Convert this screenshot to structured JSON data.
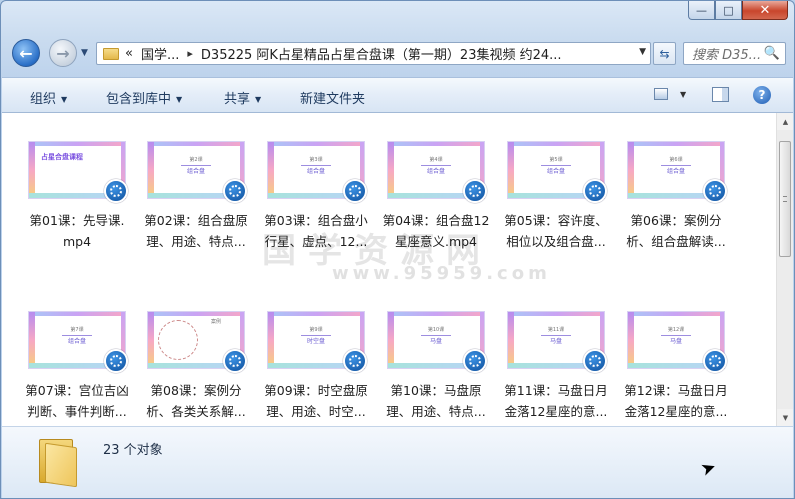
{
  "window": {
    "minimize": "—",
    "maximize": "□",
    "close": "✕"
  },
  "nav": {
    "back": "←",
    "forward": "→",
    "history": "▼"
  },
  "address": {
    "nav_arrows": "«",
    "crumbs": [
      "国学...",
      "D35225 阿K占星精品占星合盘课（第一期）23集视频 约24..."
    ],
    "dropdown": "▼"
  },
  "refresh": "⇆",
  "search": {
    "placeholder": "搜索 D35...",
    "icon": "🔍"
  },
  "toolbar": {
    "organize": "组织",
    "include_library": "包含到库中",
    "share": "共享",
    "new_folder": "新建文件夹",
    "arrow": "▼",
    "help": "?"
  },
  "watermark": {
    "text": "国学资源网",
    "url": "www.95959.com"
  },
  "files": [
    {
      "name_line1": "第01课：先导课.",
      "name_line2": "mp4",
      "thumb_type": "cover",
      "thumb_title": "占星合盘课程"
    },
    {
      "name_line1": "第02课：组合盘原",
      "name_line2": "理、用途、特点...",
      "thumb_type": "slide",
      "thumb_label": "第2课",
      "thumb_title": "组合盘"
    },
    {
      "name_line1": "第03课：组合盘小",
      "name_line2": "行星、虚点、12...",
      "thumb_type": "slide",
      "thumb_label": "第3课",
      "thumb_title": "组合盘"
    },
    {
      "name_line1": "第04课：组合盘12",
      "name_line2": "星座意义.mp4",
      "thumb_type": "slide",
      "thumb_label": "第4课",
      "thumb_title": "组合盘"
    },
    {
      "name_line1": "第05课：容许度、",
      "name_line2": "相位以及组合盘...",
      "thumb_type": "slide",
      "thumb_label": "第5课",
      "thumb_title": "组合盘"
    },
    {
      "name_line1": "第06课：案例分",
      "name_line2": "析、组合盘解读...",
      "thumb_type": "slide",
      "thumb_label": "第6课",
      "thumb_title": "组合盘"
    },
    {
      "name_line1": "第07课：宫位吉凶",
      "name_line2": "判断、事件判断...",
      "thumb_type": "slide",
      "thumb_label": "第7课",
      "thumb_title": "组合盘"
    },
    {
      "name_line1": "第08课：案例分",
      "name_line2": "析、各类关系解...",
      "thumb_type": "chart",
      "thumb_label": "案例",
      "thumb_title": ""
    },
    {
      "name_line1": "第09课：时空盘原",
      "name_line2": "理、用途、时空...",
      "thumb_type": "slide",
      "thumb_label": "第9课",
      "thumb_title": "时空盘"
    },
    {
      "name_line1": "第10课：马盘原",
      "name_line2": "理、用途、特点...",
      "thumb_type": "slide",
      "thumb_label": "第10课",
      "thumb_title": "马盘"
    },
    {
      "name_line1": "第11课：马盘日月",
      "name_line2": "金落12星座的意...",
      "thumb_type": "slide",
      "thumb_label": "第11课",
      "thumb_title": "马盘"
    },
    {
      "name_line1": "第12课：马盘日月",
      "name_line2": "金落12星座的意...",
      "thumb_type": "slide",
      "thumb_label": "第12课",
      "thumb_title": "马盘"
    }
  ],
  "scrollbar": {
    "up": "▲",
    "down": "▼"
  },
  "status": {
    "count_text": "23 个对象"
  },
  "cursor": "➤"
}
